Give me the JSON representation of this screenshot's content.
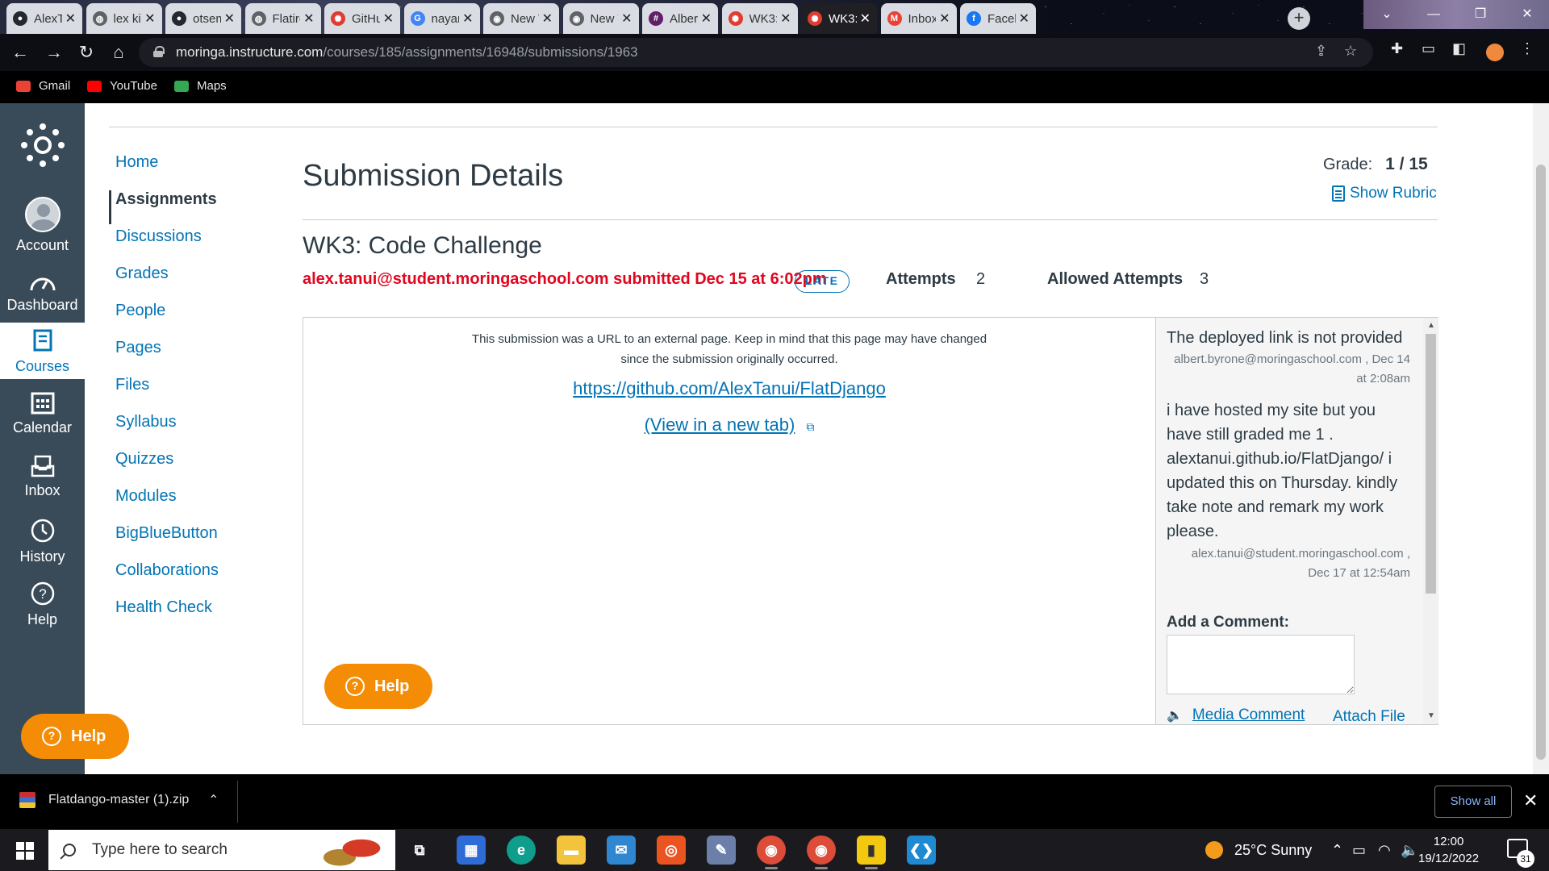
{
  "browser": {
    "tabs": [
      {
        "title": "AlexTa",
        "icon": "github-icon"
      },
      {
        "title": "lex kip",
        "icon": "globe-icon"
      },
      {
        "title": "otsem",
        "icon": "github-icon"
      },
      {
        "title": "Flatiro",
        "icon": "globe-icon"
      },
      {
        "title": "GitHu",
        "icon": "canvas-icon"
      },
      {
        "title": "nayan",
        "icon": "google-icon"
      },
      {
        "title": "New T",
        "icon": "chrome-icon"
      },
      {
        "title": "New T",
        "icon": "chrome-icon"
      },
      {
        "title": "Albert",
        "icon": "slack-icon"
      },
      {
        "title": "WK3:",
        "icon": "canvas-icon"
      },
      {
        "title": "WK3:",
        "icon": "canvas-icon"
      },
      {
        "title": "Inbox",
        "icon": "gmail-icon"
      },
      {
        "title": "Faceb",
        "icon": "facebook-icon"
      }
    ],
    "active_tab_index": 10,
    "url_host": "moringa.instructure.com",
    "url_path": "/courses/185/assignments/16948/submissions/1963",
    "bookmarks": [
      {
        "label": "Gmail",
        "color": "#ea4335"
      },
      {
        "label": "YouTube",
        "color": "#ff0000"
      },
      {
        "label": "Maps",
        "color": "#34a853"
      }
    ]
  },
  "global_nav": {
    "account": "Account",
    "dashboard": "Dashboard",
    "courses": "Courses",
    "calendar": "Calendar",
    "inbox": "Inbox",
    "history": "History",
    "help": "Help",
    "help_button": "Help"
  },
  "course_nav": {
    "items": [
      "Home",
      "Assignments",
      "Discussions",
      "Grades",
      "People",
      "Pages",
      "Files",
      "Syllabus",
      "Quizzes",
      "Modules",
      "BigBlueButton",
      "Collaborations",
      "Health Check"
    ],
    "active": "Assignments"
  },
  "submission": {
    "page_title": "Submission Details",
    "grade_label": "Grade:",
    "grade_value": "1 / 15",
    "show_rubric": "Show Rubric",
    "assignment_title": "WK3: Code Challenge",
    "submitted_line": "alex.tanui@student.moringaschool.com submitted Dec 15 at 6:02pm",
    "late_badge": "LATE",
    "attempts_label": "Attempts",
    "attempts_value": "2",
    "allowed_label": "Allowed Attempts",
    "allowed_value": "3",
    "external_note": "This submission was a URL to an external page. Keep in mind that this page may have changed since the submission originally occurred.",
    "url": "https://github.com/AlexTanui/FlatDjango",
    "view_new_tab": "(View in a new tab)",
    "help_button": "Help"
  },
  "comments": {
    "items": [
      {
        "text": "The deployed link is not provided",
        "author": "albert.byrone@moringaschool.com",
        "date": "Dec 14 at 2:08am"
      },
      {
        "text": "i have hosted my site but you have still graded me 1 . alextanui.github.io/FlatDjango/ i updated this on Thursday. kindly take note and remark my work please.",
        "author": "alex.tanui@student.moringaschool.com",
        "date": "Dec 17 at 12:54am"
      }
    ],
    "add_comment_label": "Add a Comment:",
    "media_comment": "Media Comment",
    "attach_file": "Attach File"
  },
  "downloads": {
    "file": "Flatdango-master (1).zip",
    "show_all": "Show all"
  },
  "taskbar": {
    "search_placeholder": "Type here to search",
    "weather": "25°C  Sunny",
    "time": "12:00",
    "date": "19/12/2022",
    "notifications": "31"
  },
  "colors": {
    "canvas_nav": "#394b58",
    "link": "#0374b5",
    "late_red": "#e0061f",
    "help_orange": "#f48c06"
  }
}
